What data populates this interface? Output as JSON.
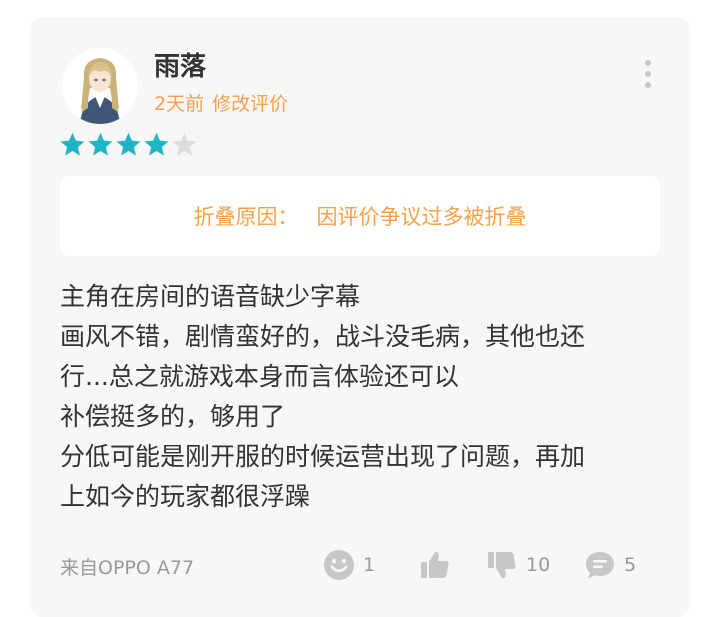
{
  "review": {
    "username": "雨落",
    "time_ago": "2天前",
    "edited_label": "修改评价",
    "rating": 4,
    "max_rating": 5,
    "fold_notice": {
      "label": "折叠原因：",
      "reason": "因评价争议过多被折叠"
    },
    "body_lines": [
      "主角在房间的语音缺少字幕",
      "画风不错，剧情蛮好的，战斗没毛病，其他也还",
      "行...总之就游戏本身而言体验还可以",
      "补偿挺多的，够用了",
      "分低可能是刚开服的时候运营出现了问题，再加",
      "上如今的玩家都很浮躁"
    ],
    "device": "来自OPPO A77",
    "actions": {
      "funny_count": "1",
      "like_count": "",
      "dislike_count": "10",
      "comment_count": "5"
    }
  },
  "colors": {
    "star_filled": "#1fb5c9",
    "star_empty": "#dddddd",
    "accent_orange": "#f5a24a",
    "icon_gray": "#c7c7c7"
  },
  "icons": {
    "more": "vertical-dots-icon",
    "funny": "smiley-icon",
    "like": "thumbs-up-icon",
    "dislike": "thumbs-down-icon",
    "comment": "speech-bubble-icon"
  }
}
